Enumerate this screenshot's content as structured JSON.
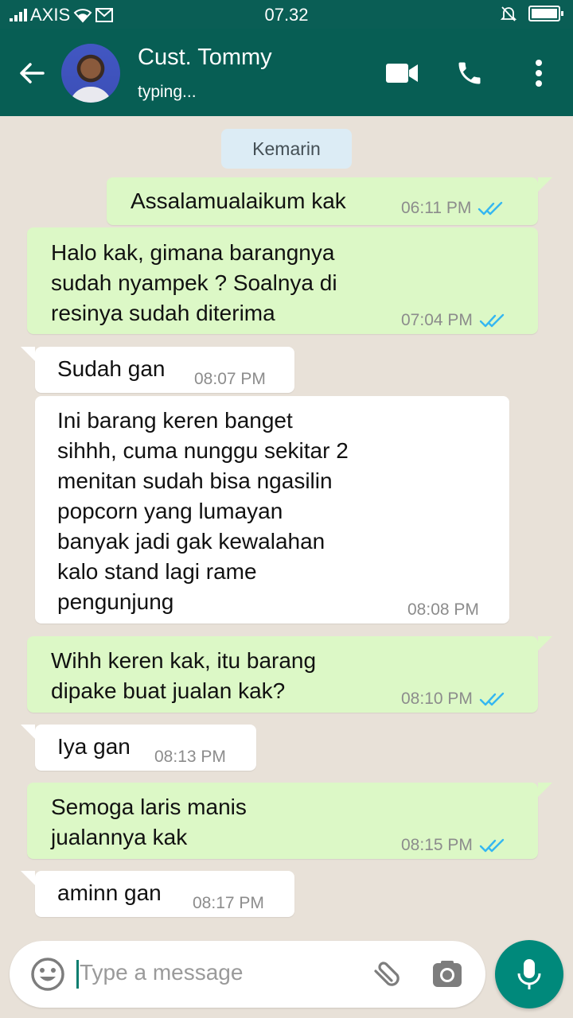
{
  "status_bar": {
    "carrier": "AXIS",
    "time": "07.32"
  },
  "header": {
    "contact_name": "Cust. Tommy",
    "status": "typing..."
  },
  "chat": {
    "date_chip": "Kemarin",
    "messages": [
      {
        "dir": "out",
        "text": "Assalamualaikum kak",
        "time": "06:11 PM",
        "read": true
      },
      {
        "dir": "out",
        "text": "Halo kak, gimana barangnya\nsudah nyampek ? Soalnya di\nresinya sudah diterima",
        "time": "07:04 PM",
        "read": true
      },
      {
        "dir": "in",
        "text": "Sudah gan",
        "time": "08:07 PM"
      },
      {
        "dir": "in",
        "text": "Ini barang keren banget\nsihhh, cuma nunggu sekitar 2\nmenitan sudah bisa ngasilin\npopcorn yang lumayan\nbanyak jadi gak kewalahan\nkalo stand lagi rame\npengunjung",
        "time": "08:08 PM"
      },
      {
        "dir": "out",
        "text": "Wihh keren kak, itu barang\ndipake buat jualan kak?",
        "time": "08:10 PM",
        "read": true
      },
      {
        "dir": "in",
        "text": "Iya gan",
        "time": "08:13 PM"
      },
      {
        "dir": "out",
        "text": "Semoga laris manis\njualannya kak",
        "time": "08:15 PM",
        "read": true
      },
      {
        "dir": "in",
        "text": "aminn gan",
        "time": "08:17 PM"
      }
    ]
  },
  "input": {
    "placeholder": "Type a message"
  },
  "colors": {
    "header": "#075e54",
    "outgoing": "#dcf8c6",
    "incoming": "#ffffff",
    "ticks": "#34b7f1",
    "mic": "#00897b"
  },
  "icons": [
    "back-arrow-icon",
    "video-call-icon",
    "phone-icon",
    "more-options-icon",
    "emoji-icon",
    "attach-icon",
    "camera-icon",
    "mic-icon",
    "double-tick-icon"
  ]
}
